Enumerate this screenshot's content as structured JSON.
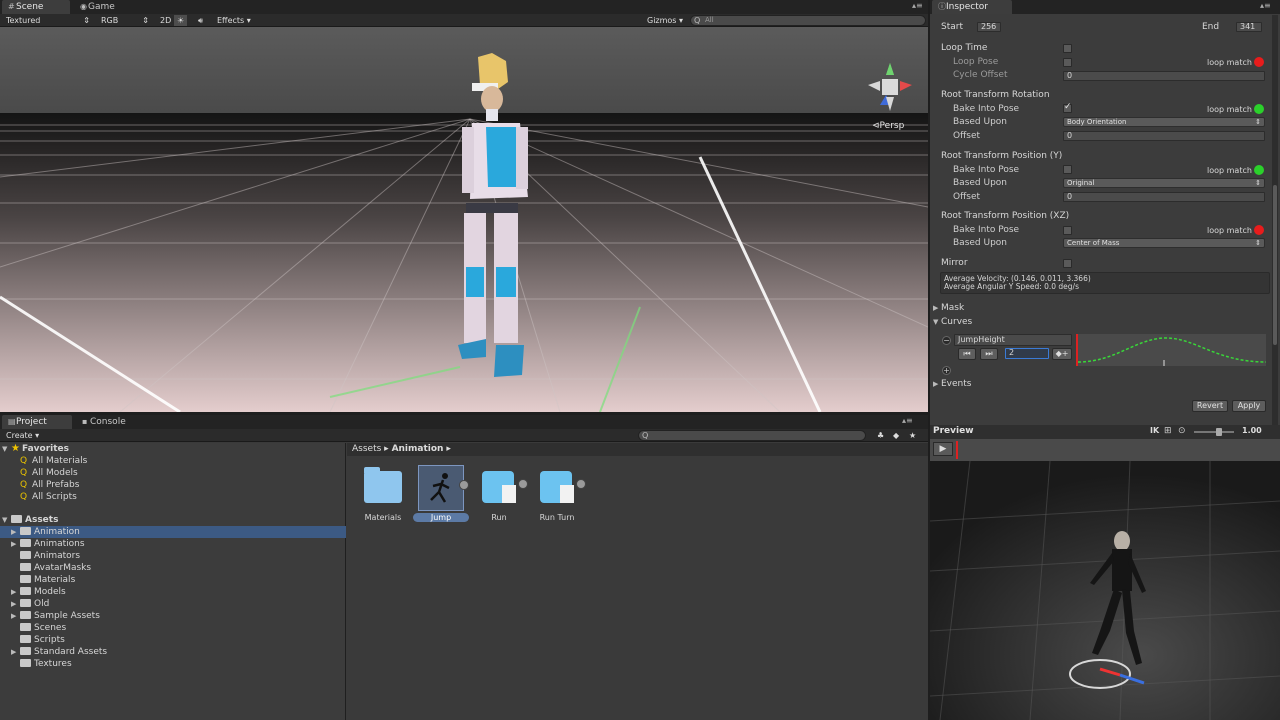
{
  "scene_panel": {
    "tabs": [
      {
        "label": "Scene"
      },
      {
        "label": "Game"
      }
    ],
    "toolbar": {
      "draw_mode": "Textured",
      "render_mode": "RGB",
      "mode_2d": "2D",
      "effects": "Effects",
      "gizmos": "Gizmos",
      "search_placeholder": "All"
    },
    "persp_label": "Persp"
  },
  "inspector": {
    "tab_label": "Inspector",
    "start_label": "Start",
    "start_value": "256",
    "end_label": "End",
    "end_value": "341",
    "loop_time": "Loop Time",
    "loop_pose": "Loop Pose",
    "cycle_offset": "Cycle Offset",
    "cycle_offset_value": "0",
    "loop_match": "loop match",
    "rot_header": "Root Transform Rotation",
    "bake_into_pose": "Bake Into Pose",
    "based_upon": "Based Upon",
    "offset": "Offset",
    "rot_based_value": "Body Orientation",
    "rot_offset_value": "0",
    "posy_header": "Root Transform Position (Y)",
    "posy_based_value": "Original",
    "posy_offset_value": "0",
    "posxz_header": "Root Transform Position (XZ)",
    "posxz_based_value": "Center of Mass",
    "mirror": "Mirror",
    "avg_velocity": "Average Velocity: (0.146, 0.011, 3.366)",
    "avg_angular": "Average Angular Y Speed: 0.0 deg/s",
    "mask": "Mask",
    "curves": "Curves",
    "curve_name": "JumpHeight",
    "curve_value": "2",
    "events": "Events",
    "revert": "Revert",
    "apply": "Apply",
    "status_colors": {
      "red": "#e81c1c",
      "green": "#2bd12b"
    }
  },
  "preview": {
    "label": "Preview",
    "ik": "IK",
    "speed": "1.00"
  },
  "project_panel": {
    "tabs": [
      {
        "label": "Project"
      },
      {
        "label": "Console"
      }
    ],
    "create": "Create",
    "favorites_label": "Favorites",
    "favorites": [
      "All Materials",
      "All Models",
      "All Prefabs",
      "All Scripts"
    ],
    "assets_label": "Assets",
    "folders": [
      "Animation",
      "Animations",
      "Animators",
      "AvatarMasks",
      "Materials",
      "Models",
      "Old",
      "Sample Assets",
      "Scenes",
      "Scripts",
      "Standard Assets",
      "Textures"
    ],
    "breadcrumb": [
      "Assets",
      "Animation"
    ],
    "grid_items": [
      {
        "name": "Materials",
        "type": "folder-icon"
      },
      {
        "name": "Jump",
        "type": "animation-clip-icon"
      },
      {
        "name": "Run",
        "type": "model-prefab-icon"
      },
      {
        "name": "Run Turn",
        "type": "model-prefab-icon"
      }
    ]
  }
}
